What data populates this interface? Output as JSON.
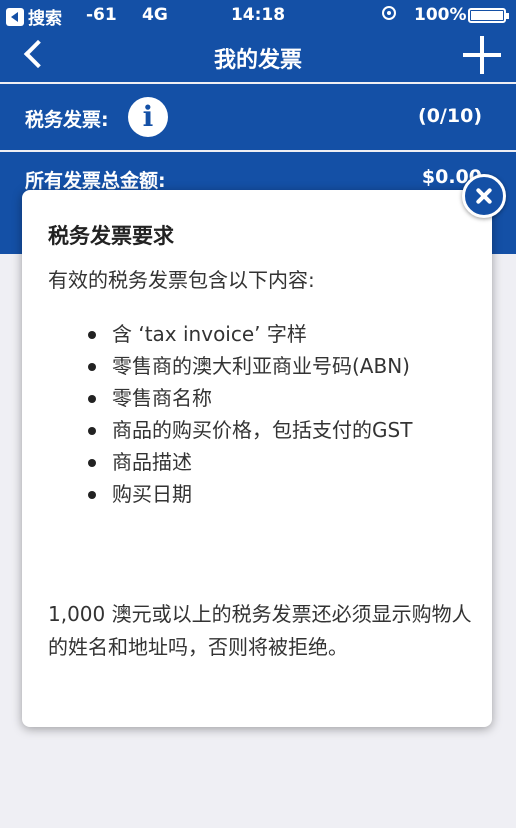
{
  "status_bar": {
    "back_app": "搜索",
    "signal": "-61",
    "network": "4G",
    "time": "14:18",
    "battery": "100%"
  },
  "nav": {
    "title": "我的发票"
  },
  "rows": {
    "tax_invoice_label": "税务发票:",
    "tax_invoice_count": "(0/10)",
    "total_label": "所有发票总金额:",
    "total_value": "$0.00"
  },
  "modal": {
    "title": "税务发票要求",
    "intro": "有效的税务发票包含以下内容:",
    "items": [
      "含 ‘tax invoice’ 字样",
      "零售商的澳大利亚商业号码(ABN)",
      "零售商名称",
      "商品的购买价格，包括支付的GST",
      "商品描述",
      "购买日期"
    ],
    "note": "1,000 澳元或以上的税务发票还必须显示购物人的姓名和地址吗，否则将被拒绝。"
  },
  "icons": {
    "info": "info-icon",
    "close": "close-icon",
    "plus": "plus-icon",
    "back": "chevron-left-icon"
  },
  "colors": {
    "brand_blue": "#1450a6",
    "background": "#efeff4"
  }
}
